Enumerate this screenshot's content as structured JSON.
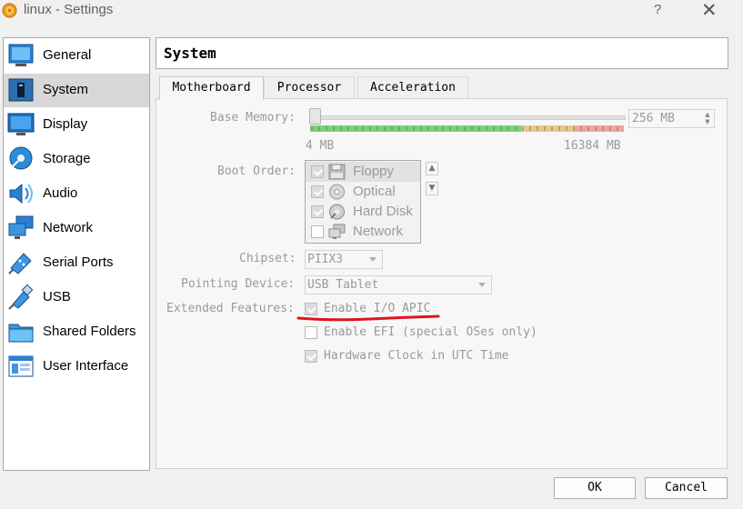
{
  "window": {
    "title": "linux - Settings",
    "help": "?",
    "close": "✕"
  },
  "sidebar": {
    "items": [
      {
        "label": "General",
        "icon": "general-icon"
      },
      {
        "label": "System",
        "icon": "system-icon",
        "active": true
      },
      {
        "label": "Display",
        "icon": "display-icon"
      },
      {
        "label": "Storage",
        "icon": "storage-icon"
      },
      {
        "label": "Audio",
        "icon": "audio-icon"
      },
      {
        "label": "Network",
        "icon": "network-icon"
      },
      {
        "label": "Serial Ports",
        "icon": "serial-ports-icon"
      },
      {
        "label": "USB",
        "icon": "usb-icon"
      },
      {
        "label": "Shared Folders",
        "icon": "shared-folders-icon"
      },
      {
        "label": "User Interface",
        "icon": "user-interface-icon"
      }
    ]
  },
  "page": {
    "title": "System"
  },
  "tabs": [
    {
      "label": "Motherboard",
      "active": true
    },
    {
      "label": "Processor"
    },
    {
      "label": "Acceleration"
    }
  ],
  "motherboard": {
    "base_memory": {
      "label": "Base Memory:",
      "value": "256 MB",
      "slider_value_mb": 256,
      "min_label": "4 MB",
      "max_label": "16384 MB"
    },
    "boot_order": {
      "label": "Boot Order:",
      "items": [
        {
          "label": "Floppy",
          "checked": true
        },
        {
          "label": "Optical",
          "checked": true
        },
        {
          "label": "Hard Disk",
          "checked": true
        },
        {
          "label": "Network",
          "checked": false
        }
      ],
      "up_arrow": "▲",
      "down_arrow": "▼"
    },
    "chipset": {
      "label": "Chipset:",
      "value": "PIIX3"
    },
    "pointing_device": {
      "label": "Pointing Device:",
      "value": "USB Tablet"
    },
    "extended_features": {
      "label": "Extended Features:",
      "options": [
        {
          "label": "Enable I/O APIC",
          "checked": true
        },
        {
          "label": "Enable EFI (special OSes only)",
          "checked": false
        },
        {
          "label": "Hardware Clock in UTC Time",
          "checked": true
        }
      ]
    }
  },
  "buttons": {
    "ok": "OK",
    "cancel": "Cancel"
  },
  "colors": {
    "slider_green": "#7ad27a",
    "slider_orange": "#f1c48a",
    "slider_red": "#f3a3a3",
    "annotation_red": "#e0141e"
  }
}
